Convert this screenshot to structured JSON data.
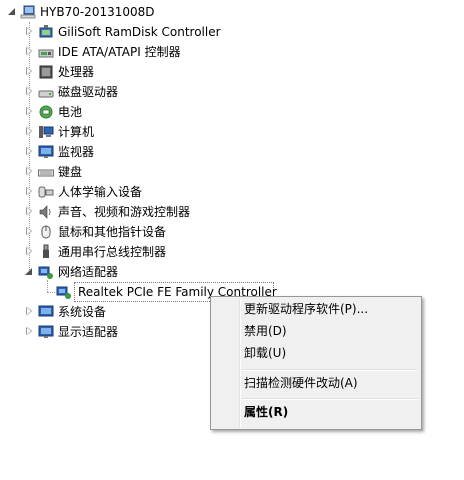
{
  "tree": {
    "root": "HYB70-20131008D",
    "items": [
      {
        "label": "GiliSoft RamDisk Controller",
        "icon": "controller-icon"
      },
      {
        "label": "IDE ATA/ATAPI 控制器",
        "icon": "ide-controller-icon"
      },
      {
        "label": "处理器",
        "icon": "processor-icon"
      },
      {
        "label": "磁盘驱动器",
        "icon": "disk-drive-icon"
      },
      {
        "label": "电池",
        "icon": "battery-icon"
      },
      {
        "label": "计算机",
        "icon": "computer-icon"
      },
      {
        "label": "监视器",
        "icon": "monitor-icon"
      },
      {
        "label": "键盘",
        "icon": "keyboard-icon"
      },
      {
        "label": "人体学输入设备",
        "icon": "hid-icon"
      },
      {
        "label": "声音、视频和游戏控制器",
        "icon": "sound-icon"
      },
      {
        "label": "鼠标和其他指针设备",
        "icon": "mouse-icon"
      },
      {
        "label": "通用串行总线控制器",
        "icon": "usb-icon"
      },
      {
        "label": "网络适配器",
        "icon": "network-adapter-icon"
      }
    ],
    "selected_child": "Realtek PCIe FE Family Controller",
    "after_items": [
      {
        "label": "系统设备",
        "icon": "system-device-icon"
      },
      {
        "label": "显示适配器",
        "icon": "display-adapter-icon"
      }
    ]
  },
  "context_menu": {
    "update_driver": "更新驱动程序软件(P)...",
    "disable": "禁用(D)",
    "uninstall": "卸载(U)",
    "scan": "扫描检测硬件改动(A)",
    "properties": "属性(R)"
  },
  "colors": {
    "menu_bg": "#f0f0f0",
    "menu_border": "#979797"
  }
}
